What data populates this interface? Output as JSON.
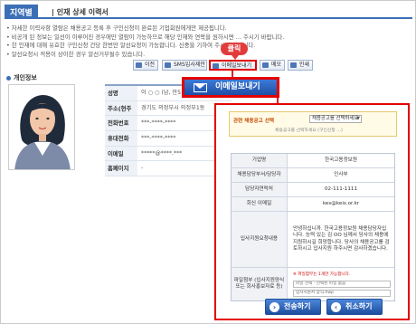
{
  "header": {
    "tag": "지역별",
    "title": "| 인재 상세 이력서"
  },
  "notes": [
    "• 자세한 이력사항 열람은 채용공고 등록 후 구인신청이 완료된 기업회원에게만 제공됩니다.",
    "• 비공개 된 정보는 일선이 이루어진 경우에만 열람이 가능하므로 해당 인재와 연락을 원하시면 … 주시기 바랍니다.",
    "• 한 인재에 대해 유효한 구인신청 건당 한번만 알선요청이 가능합니다. 신중을 기하여 주시기 바랍니다.",
    "• 알선요청시 적용이 상이한 경우 알선거부될수 있습니다."
  ],
  "notes_emphasis": "한번만 알선요청",
  "toolbar": {
    "prev": "이전",
    "sms": "SMS입사제안",
    "email": "이메일보내기",
    "memo": "메모",
    "print": "인쇄"
  },
  "click_badge": "클릭",
  "big_email_button": "이메일보내기",
  "personal_section": "개인정보",
  "info": [
    {
      "label": "성명",
      "value": "이 ○ ○ (남, 만51세) (여성/...)"
    },
    {
      "label": "주소(현주소)",
      "value": "경기도 의정부시 의정부1동"
    },
    {
      "label": "전화번호",
      "value": "***-****-****"
    },
    {
      "label": "휴대전화",
      "value": "***-****-****"
    },
    {
      "label": "이메일",
      "value": "*****@****.***"
    },
    {
      "label": "홈페이지",
      "value": "-"
    }
  ],
  "form": {
    "select_label": "관련 채용공고 선택",
    "select_value": "채용공고를 선택하세요",
    "select_note": "채용공고를 선택하세요 (구인신청 …)",
    "rows": [
      {
        "label": "기업명",
        "value": "한국고용정보원"
      },
      {
        "label": "채용담당부서/담당자",
        "value": "인사부"
      },
      {
        "label": "담당자연락처",
        "value": "02-111-1111"
      },
      {
        "label": "회신 이메일",
        "value": "kes@keis.or.kr"
      },
      {
        "label": "입사지원요청내용",
        "value": "안녕하십니까. 한국고용정보원 채용담당자입니다. 능력 있는 김 OO 님께서 당사의 채용에 지원하시길 희망합니다. 당사의 채용공고를 검토하시고 입사지원 하주시면 감사하겠습니다."
      },
      {
        "label": "파일첨부 (입사지원양식 또는 회사홍보자료 등)",
        "value": ""
      }
    ],
    "attach_note": "※ 파일첨부는 1개만 가능합니다.",
    "attach_field": "파일 선택 · 선택된 파일 없음",
    "attach_field2": "입사지원서 양식.hwp",
    "send": "전송하기",
    "cancel": "취소하기"
  },
  "colors": {
    "accent": "#3b6fb6",
    "highlight": "#e30000",
    "button": "#1f4fa7"
  }
}
